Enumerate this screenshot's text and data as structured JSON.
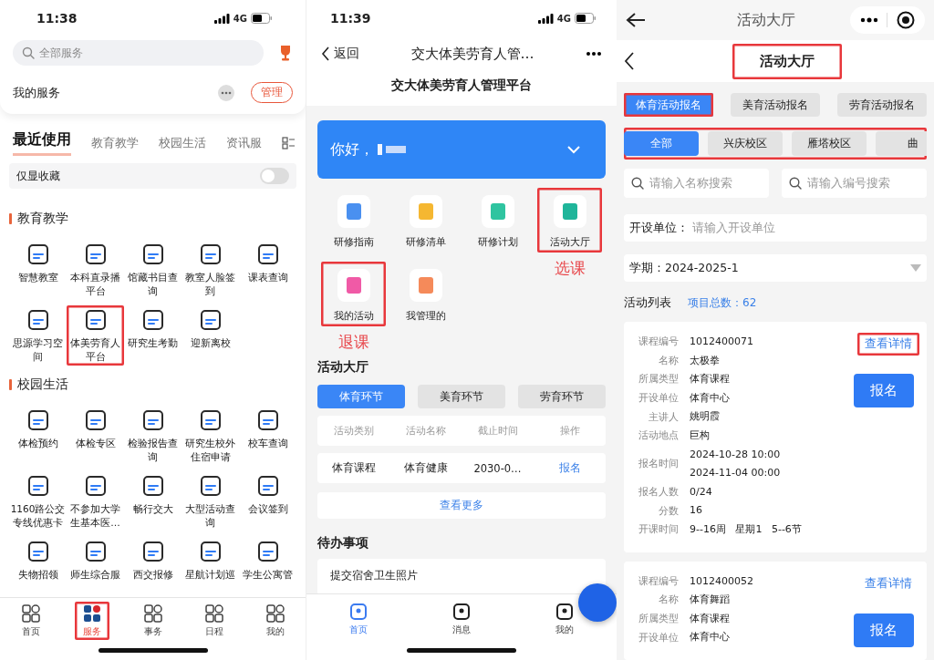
{
  "services_screen": {
    "status_bar": {
      "time": "11:38",
      "network": "4G"
    },
    "search": {
      "placeholder": "全部服务"
    },
    "my_services": {
      "title": "我的服务",
      "manage_button": "管理"
    },
    "tabs": [
      {
        "label": "最近使用",
        "selected": true
      },
      {
        "label": "教育教学",
        "selected": false
      },
      {
        "label": "校园生活",
        "selected": false
      },
      {
        "label": "资讯服",
        "selected": false
      }
    ],
    "favorites_toggle": {
      "label": "仅显收藏",
      "on": false
    },
    "sections": [
      {
        "title": "教育教学",
        "items": [
          {
            "label": "智慧教室",
            "highlighted": false
          },
          {
            "label": "本科直录播平台",
            "highlighted": false
          },
          {
            "label": "馆藏书目查询",
            "highlighted": false
          },
          {
            "label": "教室人脸签到",
            "highlighted": false
          },
          {
            "label": "课表查询",
            "highlighted": false
          },
          {
            "label": "思源学习空间",
            "highlighted": false
          },
          {
            "label": "体美劳育人平台",
            "highlighted": true
          },
          {
            "label": "研究生考勤",
            "highlighted": false
          },
          {
            "label": "迎新离校",
            "highlighted": false
          }
        ]
      },
      {
        "title": "校园生活",
        "items": [
          {
            "label": "体检预约",
            "highlighted": false
          },
          {
            "label": "体检专区",
            "highlighted": false
          },
          {
            "label": "检验报告查询",
            "highlighted": false
          },
          {
            "label": "研究生校外住宿申请",
            "highlighted": false
          },
          {
            "label": "校车查询",
            "highlighted": false
          },
          {
            "label": "1160路公交专线优惠卡",
            "highlighted": false
          },
          {
            "label": "不参加大学生基本医…",
            "highlighted": false
          },
          {
            "label": "畅行交大",
            "highlighted": false
          },
          {
            "label": "大型活动查询",
            "highlighted": false
          },
          {
            "label": "会议签到",
            "highlighted": false
          },
          {
            "label": "失物招领",
            "highlighted": false
          },
          {
            "label": "师生综合服",
            "highlighted": false
          },
          {
            "label": "西交报修",
            "highlighted": false
          },
          {
            "label": "星航计划巡",
            "highlighted": false
          },
          {
            "label": "学生公寓管",
            "highlighted": false
          }
        ]
      }
    ],
    "bottom_nav": [
      {
        "label": "首页",
        "selected": false,
        "highlighted": false
      },
      {
        "label": "服务",
        "selected": true,
        "highlighted": true
      },
      {
        "label": "事务",
        "selected": false,
        "highlighted": false
      },
      {
        "label": "日程",
        "selected": false,
        "highlighted": false
      },
      {
        "label": "我的",
        "selected": false,
        "highlighted": false
      }
    ]
  },
  "platform_screen": {
    "status_bar": {
      "time": "11:39",
      "network": "4G"
    },
    "nav": {
      "back_label": "返回",
      "title": "交大体美劳育人管…"
    },
    "page_title": "交大体美劳育人管理平台",
    "greeting": "你好，",
    "apps": [
      {
        "label": "研修指南",
        "color": "#4a90f0",
        "highlighted": false
      },
      {
        "label": "研修清单",
        "color": "#f5b731",
        "highlighted": false
      },
      {
        "label": "研修计划",
        "color": "#2fc4a0",
        "highlighted": false
      },
      {
        "label": "活动大厅",
        "color": "#1fb59a",
        "highlighted": true,
        "annotation": "选课"
      },
      {
        "label": "我的活动",
        "color": "#f05aa6",
        "highlighted": true,
        "annotation": "退课"
      },
      {
        "label": "我管理的",
        "color": "#f58a5a",
        "highlighted": false
      }
    ],
    "hall": {
      "title": "活动大厅",
      "tabs": [
        {
          "label": "体育环节",
          "selected": true
        },
        {
          "label": "美育环节",
          "selected": false
        },
        {
          "label": "劳育环节",
          "selected": false
        }
      ],
      "columns": [
        "活动类别",
        "活动名称",
        "截止时间",
        "操作"
      ],
      "rows": [
        {
          "category": "体育课程",
          "name": "体育健康",
          "deadline": "2030-0…",
          "action": "报名"
        }
      ],
      "more_link": "查看更多"
    },
    "todo": {
      "title": "待办事项",
      "items": [
        "提交宿舍卫生照片"
      ]
    },
    "bottom_nav": [
      {
        "label": "首页",
        "selected": true
      },
      {
        "label": "消息",
        "selected": false
      },
      {
        "label": "我的",
        "selected": false
      }
    ]
  },
  "activity_screen": {
    "top_bar": {
      "title": "活动大厅"
    },
    "header": {
      "title": "活动大厅",
      "highlighted": true
    },
    "category_tabs": [
      {
        "label": "体育活动报名",
        "selected": true,
        "highlighted": true
      },
      {
        "label": "美育活动报名",
        "selected": false,
        "highlighted": false
      },
      {
        "label": "劳育活动报名",
        "selected": false,
        "highlighted": false
      }
    ],
    "campus_filter": {
      "highlighted": true,
      "chips": [
        {
          "label": "全部",
          "selected": true
        },
        {
          "label": "兴庆校区",
          "selected": false
        },
        {
          "label": "雁塔校区",
          "selected": false
        },
        {
          "label": "曲",
          "selected": false
        }
      ]
    },
    "name_search": {
      "placeholder": "请输入名称搜索"
    },
    "code_search": {
      "placeholder": "请输入编号搜索"
    },
    "unit_field": {
      "label": "开设单位：",
      "placeholder": "请输入开设单位"
    },
    "term_select": {
      "label": "学期：",
      "value": "2024-2025-1"
    },
    "list": {
      "title": "活动列表",
      "total": "项目总数：62"
    },
    "courses": [
      {
        "detail_link": "查看详情",
        "detail_highlighted": true,
        "signup_button": "报名",
        "fields": [
          {
            "label": "课程编号",
            "values": [
              "1012400071"
            ]
          },
          {
            "label": "名称",
            "values": [
              "太极拳"
            ]
          },
          {
            "label": "所属类型",
            "values": [
              "体育课程"
            ]
          },
          {
            "label": "开设单位",
            "values": [
              "体育中心"
            ]
          },
          {
            "label": "主讲人",
            "values": [
              "姚明霞"
            ]
          },
          {
            "label": "活动地点",
            "values": [
              "巨构"
            ]
          },
          {
            "label": "报名时间",
            "values": [
              "2024-10-28 10:00",
              "2024-11-04 00:00"
            ]
          },
          {
            "label": "报名人数",
            "values": [
              "0/24"
            ]
          },
          {
            "label": "分数",
            "values": [
              "16"
            ]
          },
          {
            "label": "开课时间",
            "values": [
              "9--16周   星期1   5--6节"
            ]
          }
        ]
      },
      {
        "detail_link": "查看详情",
        "detail_highlighted": false,
        "signup_button": "报名",
        "fields": [
          {
            "label": "课程编号",
            "values": [
              "1012400052"
            ]
          },
          {
            "label": "名称",
            "values": [
              "体育舞蹈"
            ]
          },
          {
            "label": "所属类型",
            "values": [
              "体育课程"
            ]
          },
          {
            "label": "开设单位",
            "values": [
              "体育中心"
            ]
          }
        ]
      }
    ]
  }
}
